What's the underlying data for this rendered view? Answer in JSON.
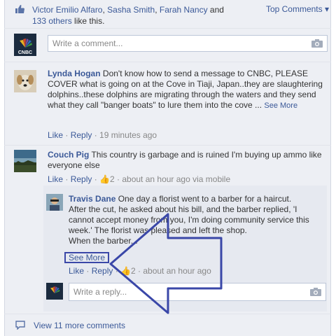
{
  "likes": {
    "names_line1_a": "Victor Emilio Alfaro",
    "sep1": ", ",
    "names_line1_b": "Sasha Smith",
    "sep2": ", ",
    "names_line1_c": "Farah Nancy",
    "and": " and",
    "others_link": "133 others",
    "like_this": " like this."
  },
  "top_comments": "Top Comments ▾",
  "comment_input": {
    "placeholder": "Write a comment..."
  },
  "comments": [
    {
      "author": "Lynda Hogan",
      "text": "Don't know how to send a message to CNBC, PLEASE COVER what is going on at the Cove in Tiaji, Japan..they are slaughtering dolphins..these dolphins are migrating through the waters and they send what they call \"banger boats\" to lure them into the cove ...",
      "see_more": "See More",
      "like": "Like",
      "reply": "Reply",
      "time": "19 minutes ago"
    },
    {
      "author": "Couch Pig",
      "text": "This country is garbage and is ruined I'm buying up ammo like everyone else",
      "like": "Like",
      "reply": "Reply",
      "like_count": "2",
      "time": "about an hour ago via mobile"
    }
  ],
  "reply": {
    "author": "Travis Dane",
    "text_line1": "One day a florist went to a barber for a haircut.",
    "text_line2": "After the cut, he asked about his bill, and the barber replied, 'I",
    "text_line3": "cannot accept money from you, I'm doing community service this",
    "text_line4": "week.' The florist was pleased and left the shop.",
    "text_line5": "When the barber...",
    "see_more": "See More",
    "like": "Like",
    "reply": "Reply",
    "like_count": "2",
    "time": "about an hour ago"
  },
  "reply_input": {
    "placeholder": "Write a reply..."
  },
  "view_more": "View 11 more comments",
  "colors": {
    "link": "#3b5998",
    "panel": "#edeff4",
    "annotation": "#3a47a8"
  }
}
